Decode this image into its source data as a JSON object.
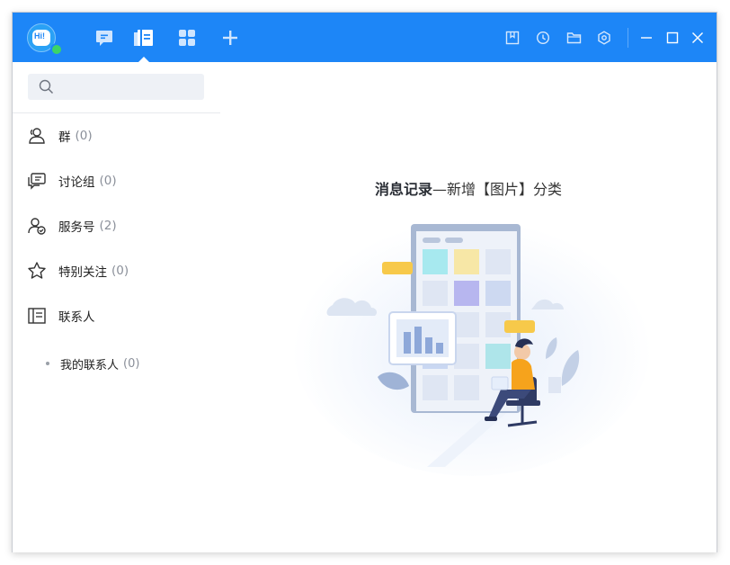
{
  "titlebar": {
    "avatar_text": "Hi!",
    "nav": [
      {
        "name": "messages",
        "icon": "chat-bubble-icon"
      },
      {
        "name": "contacts",
        "icon": "contacts-book-icon",
        "active": true
      },
      {
        "name": "apps",
        "icon": "grid-icon"
      },
      {
        "name": "add",
        "icon": "plus-icon"
      }
    ],
    "tools": [
      {
        "name": "notes",
        "icon": "bookmark-icon"
      },
      {
        "name": "history",
        "icon": "history-icon"
      },
      {
        "name": "files",
        "icon": "folder-icon"
      },
      {
        "name": "settings",
        "icon": "hexagon-settings-icon"
      }
    ],
    "window_controls": [
      "minimize-icon",
      "maximize-icon",
      "close-icon"
    ]
  },
  "search": {
    "value": "",
    "placeholder": ""
  },
  "sidebar": {
    "items": [
      {
        "label": "群",
        "count": "(0)",
        "icon": "group-icon"
      },
      {
        "label": "讨论组",
        "count": "(0)",
        "icon": "discussion-icon"
      },
      {
        "label": "服务号",
        "count": "(2)",
        "icon": "service-account-icon"
      },
      {
        "label": "特别关注",
        "count": "(0)",
        "icon": "star-icon"
      },
      {
        "label": "联系人",
        "count": "",
        "icon": "contacts-card-icon"
      }
    ],
    "sub_item": {
      "label": "我的联系人",
      "count": "(0)"
    }
  },
  "content": {
    "headline_bold": "消息记录",
    "headline_rest": "—新增【图片】分类"
  },
  "colors": {
    "accent": "#1d86f7",
    "online": "#3cd566",
    "figure_shirt": "#f6a31c"
  }
}
